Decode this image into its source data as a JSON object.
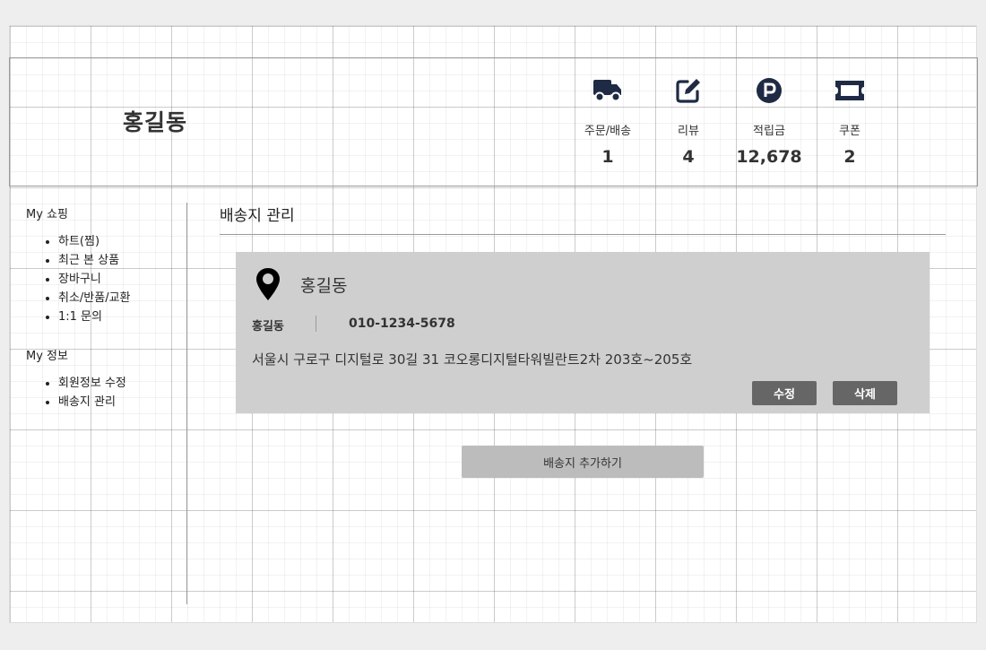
{
  "header": {
    "user_name": "홍길동",
    "stats": [
      {
        "label": "주문/배송",
        "value": "1",
        "icon": "truck-icon"
      },
      {
        "label": "리뷰",
        "value": "4",
        "icon": "edit-icon"
      },
      {
        "label": "적립금",
        "value": "12,678",
        "icon": "point-icon"
      },
      {
        "label": "쿠폰",
        "value": "2",
        "icon": "ticket-icon"
      }
    ]
  },
  "sidebar": {
    "shopping_title": "My 쇼핑",
    "shopping_items": [
      "하트(찜)",
      "최근 본 상품",
      "장바구니",
      "취소/반품/교환",
      "1:1 문의"
    ],
    "info_title": "My 정보",
    "info_items": [
      "회원정보 수정",
      "배송지 관리"
    ]
  },
  "main": {
    "title": "배송지 관리",
    "address_card": {
      "name": "홍길동",
      "recipient": "홍길동",
      "phone": "010-1234-5678",
      "address": "서울시 구로구 디지털로 30길 31 코오롱디지털타워빌란트2차 203호~205호",
      "edit_label": "수정",
      "delete_label": "삭제"
    },
    "add_label": "배송지 추가하기"
  },
  "colors": {
    "icon": "#1f2a44",
    "card_bg": "#cfcfcf",
    "button_bg": "#666666",
    "add_button_bg": "#bcbcbc"
  }
}
